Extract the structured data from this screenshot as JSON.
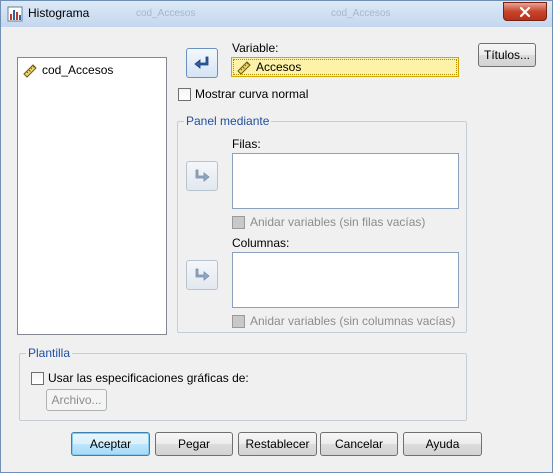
{
  "window": {
    "title": "Histograma",
    "ghost_title_1": "cod_Accesos",
    "ghost_title_2": "cod_Accesos"
  },
  "source_list": {
    "items": [
      {
        "label": "cod_Accesos",
        "icon": "ruler-icon"
      }
    ]
  },
  "variable": {
    "label": "Variable:",
    "value": "Accesos",
    "icon": "ruler-icon"
  },
  "normal_curve": {
    "label": "Mostrar curva normal",
    "checked": false
  },
  "panel": {
    "legend": "Panel mediante",
    "rows_label": "Filas:",
    "rows_nest_label": "Anidar variables (sin filas vacías)",
    "columns_label": "Columnas:",
    "columns_nest_label": "Anidar variables (sin columnas vacías)"
  },
  "template": {
    "legend": "Plantilla",
    "use_label": "Usar las especificaciones gráficas de:",
    "file_button": "Archivo..."
  },
  "buttons": {
    "titles": "Títulos...",
    "accept": "Aceptar",
    "paste": "Pegar",
    "reset": "Restablecer",
    "cancel": "Cancelar",
    "help": "Ayuda"
  },
  "colors": {
    "accent": "#1e4fa0",
    "field_highlight": "#fdf3a8",
    "close_button": "#c7442b"
  }
}
